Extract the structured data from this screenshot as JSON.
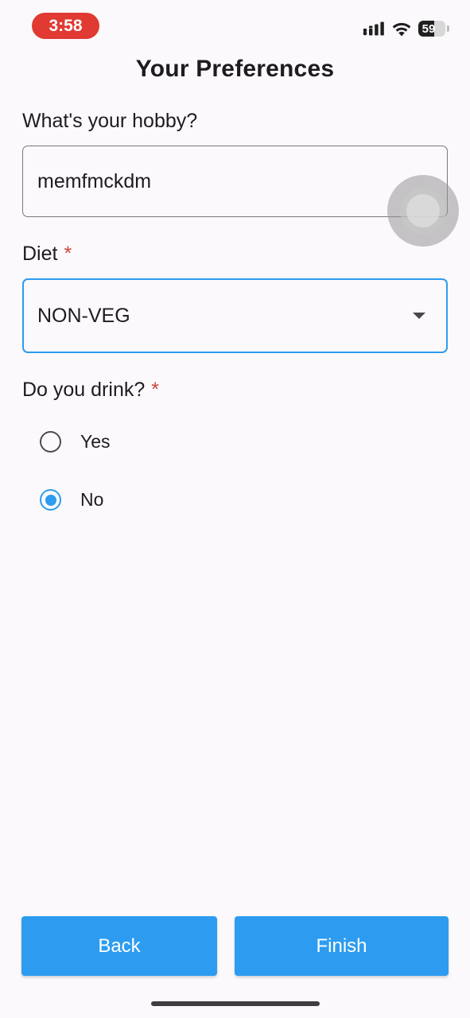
{
  "status_bar": {
    "time": "3:58",
    "battery_level": "59",
    "battery_fraction": 0.59,
    "icons": [
      "cellular-signal-icon",
      "wifi-icon",
      "battery-icon"
    ]
  },
  "page": {
    "title": "Your Preferences"
  },
  "hobby": {
    "label": "What's your hobby?",
    "value": "memfmckdm"
  },
  "diet": {
    "label": "Diet",
    "required_mark": "*",
    "selected": "NON-VEG"
  },
  "drink": {
    "label": "Do you drink?",
    "required_mark": "*",
    "options": [
      {
        "label": "Yes",
        "selected": false
      },
      {
        "label": "No",
        "selected": true
      }
    ]
  },
  "buttons": {
    "back": "Back",
    "finish": "Finish"
  },
  "colors": {
    "accent": "#2d9cf0",
    "time_pill": "#e03a32",
    "required": "#c8473a",
    "background": "#fcf9fc"
  }
}
